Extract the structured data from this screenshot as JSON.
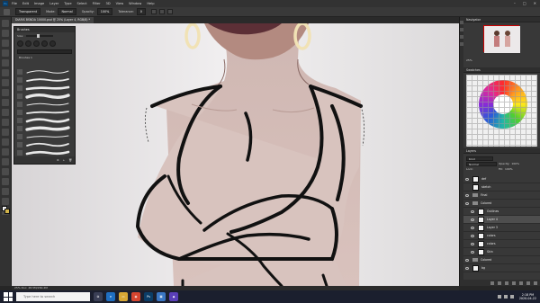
{
  "menubar": {
    "logo": "Ps",
    "items": [
      "File",
      "Edit",
      "Image",
      "Layer",
      "Type",
      "Select",
      "Filter",
      "3D",
      "View",
      "Window",
      "Help"
    ],
    "window_controls": [
      "–",
      "□",
      "✕"
    ]
  },
  "options_bar": {
    "tool_preset": "Transparent",
    "mode_label": "Mode:",
    "mode_value": "Normal",
    "opacity_label": "Opacity:",
    "opacity_value": "100%",
    "tolerance_label": "Tolerance:",
    "tolerance_value": "0"
  },
  "document": {
    "tab_title": "DIARIS BSNDA 10000.psd @ 25% (Layer 4, RGB/8) *",
    "status": "25%     Doc: 48.5M/260.2M"
  },
  "brushes_panel": {
    "title": "Brushes",
    "size_label": "Size:",
    "group_name": "Brushes 1",
    "stroke_count": 11
  },
  "navigator": {
    "title": "Navigator",
    "zoom": "25%"
  },
  "swatches": {
    "title": "Swatches"
  },
  "layers_panel": {
    "title": "Layers",
    "kind_filter": "Kind",
    "blend_mode": "Normal",
    "opacity_label": "Opacity:",
    "opacity_value": "100%",
    "lock_label": "Lock:",
    "fill_label": "Fill:",
    "fill_value": "100%",
    "layers": [
      {
        "name": "def",
        "type": "layer",
        "visible": true,
        "selected": false,
        "indent": false
      },
      {
        "name": "sketch",
        "type": "layer",
        "visible": false,
        "selected": false,
        "indent": false
      },
      {
        "name": "Final",
        "type": "folder",
        "visible": true,
        "selected": false,
        "indent": false
      },
      {
        "name": "Colored",
        "type": "folder",
        "visible": true,
        "selected": false,
        "indent": false
      },
      {
        "name": "Outlines",
        "type": "layer",
        "visible": true,
        "selected": false,
        "indent": true
      },
      {
        "name": "Layer 4",
        "type": "layer",
        "visible": true,
        "selected": true,
        "indent": true
      },
      {
        "name": "Layer 3",
        "type": "layer",
        "visible": true,
        "selected": false,
        "indent": true
      },
      {
        "name": "colors",
        "type": "layer",
        "visible": true,
        "selected": false,
        "indent": true
      },
      {
        "name": "colors",
        "type": "layer",
        "visible": true,
        "selected": false,
        "indent": true
      },
      {
        "name": "Skin",
        "type": "layer",
        "visible": true,
        "selected": false,
        "indent": true
      },
      {
        "name": "Colored",
        "type": "folder",
        "visible": true,
        "selected": false,
        "indent": false
      },
      {
        "name": "bg",
        "type": "layer",
        "visible": true,
        "selected": false,
        "indent": false
      }
    ]
  },
  "taskbar": {
    "search_placeholder": "Type here to search",
    "apps": [
      {
        "label": "⧉",
        "color": "#3a3f55"
      },
      {
        "label": "e",
        "color": "#1f6fc2"
      },
      {
        "label": "▭",
        "color": "#d7a735"
      },
      {
        "label": "◉",
        "color": "#d6452f"
      },
      {
        "label": "Ps",
        "color": "#0b3d67"
      },
      {
        "label": "▣",
        "color": "#3a76c4"
      },
      {
        "label": "◆",
        "color": "#5a3fb8"
      }
    ],
    "time": "2:18 PM",
    "date": "2020-04-22"
  }
}
